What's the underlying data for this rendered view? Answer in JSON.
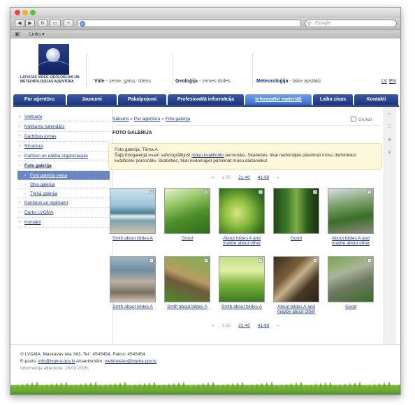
{
  "browser": {
    "search_placeholder": "Google",
    "bookmarks_label": "Links",
    "icons": {
      "back": "◀",
      "forward": "▶",
      "reload": "↻",
      "add": "+",
      "search": "🔍",
      "book": "📖"
    }
  },
  "site": {
    "logo_text": "LATVIJAS VIDES, ĢEOLOĢIJAS UN METEOROLOĢIJAS AĢENTŪRA",
    "topics": [
      {
        "title": "Vide",
        "sub": " - zeme, gaiss, ūdens"
      },
      {
        "title": "Ģeoloģija",
        "sub": " - zemes dziles"
      },
      {
        "title": "Meteoroloģija",
        "sub": " - laika apstākļi"
      }
    ],
    "lang": {
      "lv": "LV",
      "en": "EN"
    },
    "menu": [
      "Par aģentūru",
      "Jaunumi",
      "Pakalpojumi",
      "Profesionālā informācija",
      "Informatīvi materiāli",
      "Laika ziņas",
      "Kontakti"
    ],
    "menu_active_index": 4
  },
  "sidebar": {
    "items": [
      {
        "label": "Vietkarte"
      },
      {
        "label": "Notikumu kalendārs"
      },
      {
        "label": "Darbības jomas"
      },
      {
        "label": "Struktūra"
      },
      {
        "label": "Partneri un dalība organizācijās"
      },
      {
        "label": "Foto galerija"
      }
    ],
    "subitems": [
      {
        "label": "Foto galerija viena"
      },
      {
        "label": "Otra galerija"
      },
      {
        "label": "Trešā galerija"
      }
    ],
    "items_after": [
      {
        "label": "Konkursi un iepirkumi"
      },
      {
        "label": "Darbs LVĢMA"
      },
      {
        "label": "Kontakti"
      }
    ]
  },
  "content": {
    "breadcrumb": [
      "Sākums",
      "Par aģentūru",
      "Foto galerija"
    ],
    "breadcrumb_sep": "»",
    "print_label": "Drukāt",
    "title": "FOTO GALERIJA",
    "notice_line1": "Foto galerija, Tēma A",
    "notice_line2a": "Šajā fotogalerijā esam safotogrāfējuši ",
    "notice_link": "mūsu kvalificēto",
    "notice_line2b": " personālu. Skatieties, tikai nedomājiet pārvilināt mūsu darbinieku!",
    "notice_line3": "kvalificēto personālu. Skatieties, tikai nedomājiet pārvilināt mūsu darbinieku!",
    "pager": {
      "prev": "«",
      "current": "1-20",
      "links": [
        "21-40",
        "41-60"
      ],
      "next": "»"
    },
    "gallery": [
      {
        "caption": "Smth about bildes A",
        "scene": "sea"
      },
      {
        "caption": "Good",
        "scene": "hill"
      },
      {
        "caption": "About bildes A and maybe about other",
        "scene": "field"
      },
      {
        "caption": "Good",
        "scene": "forest"
      },
      {
        "caption": "About bildes A and maybe about other",
        "scene": "mountain"
      },
      {
        "caption": "Smth about bildes A",
        "scene": "pebbles"
      },
      {
        "caption": "Smth about bildes A",
        "scene": "path"
      },
      {
        "caption": "Smth about bildes A",
        "scene": "meadow"
      },
      {
        "caption": "About bildes A and maybe about other",
        "scene": "roots"
      },
      {
        "caption": "Good",
        "scene": "rocks"
      }
    ],
    "zoom_glyph": "⊕"
  },
  "footer": {
    "line1": "© LVĢMA, Maskavas iela 343, Tel.: 4545454, Fakss: 4545454.",
    "email_label": "E-pasts: ",
    "email": "info@lvgma.gov.lv",
    "webmaster_label": "  Atsauksmēm: ",
    "webmaster": "webmaster@lvgma.gov.lv",
    "updated": "Informācija atjaunota: 15.03.2005."
  },
  "colors": {
    "menu": "#2f4a96",
    "menu_active": "#5a8ce0",
    "link": "#1f3d8a",
    "sidebar_active": "#6a87c3",
    "notice_bg": "#fcf6db",
    "grass": "#6aab32"
  }
}
